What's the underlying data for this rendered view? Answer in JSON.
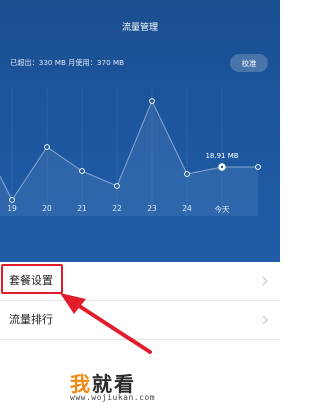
{
  "header": {
    "title": "流量管理",
    "usage_text": "已超出：330 MB 月使用：370 MB",
    "calibrate_label": "校准"
  },
  "chart_data": {
    "type": "line",
    "categories": [
      "19",
      "20",
      "21",
      "22",
      "23",
      "24",
      "今天"
    ],
    "highlight": {
      "category": "今天",
      "label": "18.91 MB"
    },
    "show_y_axis": false,
    "grid": "vertical"
  },
  "menu": {
    "items": [
      {
        "label": "套餐设置"
      },
      {
        "label": "流量排行"
      }
    ]
  },
  "watermark": {
    "char1": "我",
    "rest": "就看",
    "url": "www.wojiukan.com"
  },
  "colors": {
    "header_bg": "#1d57a0",
    "highlight_red": "#e11d2b",
    "watermark_orange": "#f08a12"
  }
}
